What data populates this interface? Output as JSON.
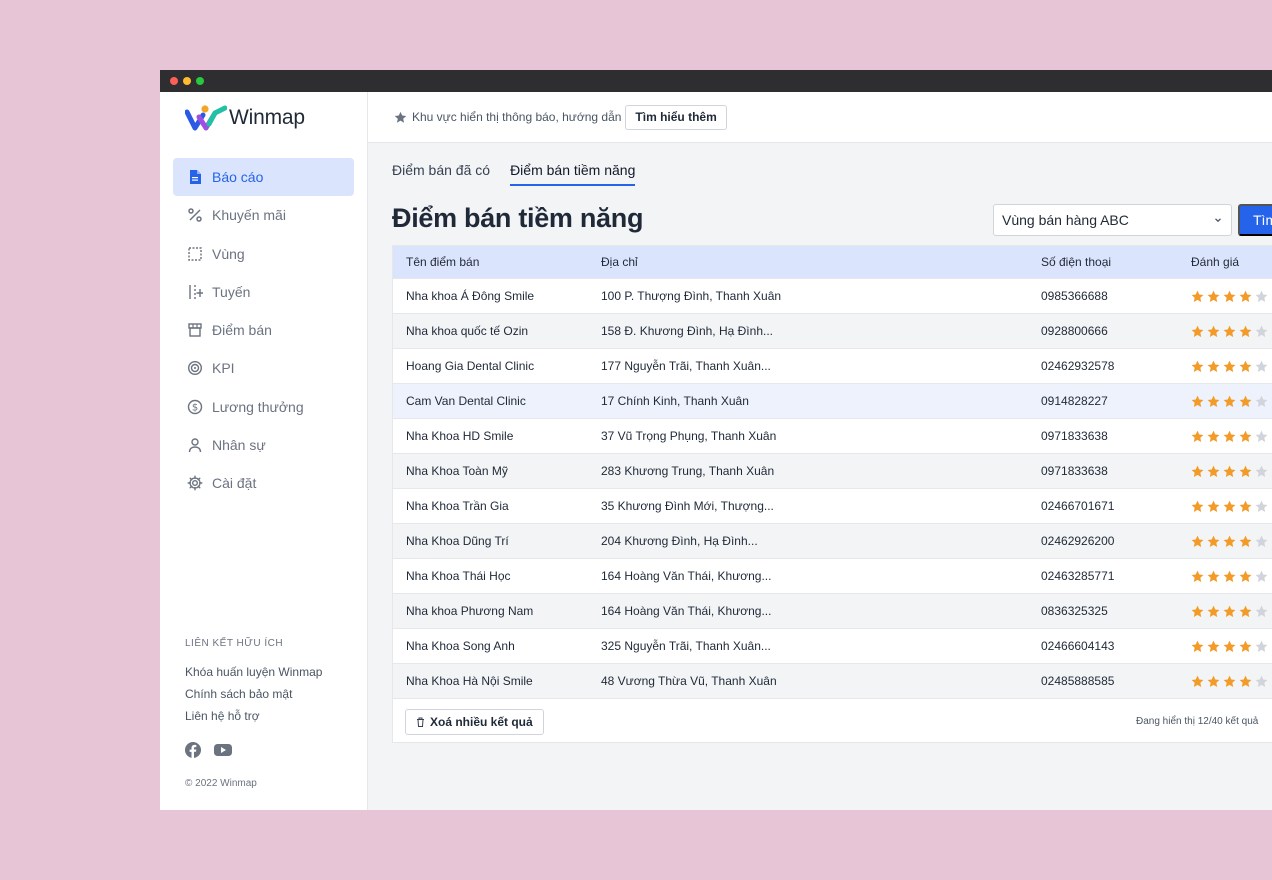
{
  "brand": {
    "name": "Winmap"
  },
  "colors": {
    "accent": "#2563eb",
    "active_bg": "#dbe4fd",
    "star": "#f29b28",
    "background": "#e8c5d6"
  },
  "sidebar": {
    "items": [
      {
        "label": "Báo cáo",
        "icon": "document-icon",
        "active": true
      },
      {
        "label": "Khuyến mãi",
        "icon": "percent-icon",
        "active": false
      },
      {
        "label": "Vùng",
        "icon": "region-icon",
        "active": false
      },
      {
        "label": "Tuyến",
        "icon": "route-icon",
        "active": false
      },
      {
        "label": "Điểm bán",
        "icon": "store-icon",
        "active": false
      },
      {
        "label": "KPI",
        "icon": "target-icon",
        "active": false
      },
      {
        "label": "Lương thưởng",
        "icon": "dollar-icon",
        "active": false
      },
      {
        "label": "Nhân sự",
        "icon": "user-icon",
        "active": false
      },
      {
        "label": "Cài đặt",
        "icon": "gear-icon",
        "active": false
      }
    ],
    "links_title": "LIÊN KẾT HỮU ÍCH",
    "links": [
      "Khóa huấn luyện Winmap",
      "Chính sách bảo mật",
      "Liên hệ hỗ trợ"
    ],
    "socials": [
      "facebook-icon",
      "youtube-icon"
    ],
    "copyright": "© 2022 Winmap"
  },
  "topbar": {
    "notice": "Khu vực hiển thị thông báo, hướng dẫn",
    "learn_more": "Tìm hiểu thêm"
  },
  "tabs": [
    {
      "label": "Điểm bán đã có",
      "active": false
    },
    {
      "label": "Điểm bán tiềm năng",
      "active": true
    }
  ],
  "page_title": "Điểm bán tiềm năng",
  "filter": {
    "region_value": "Vùng bán hàng ABC",
    "search_label": "Tìm"
  },
  "table": {
    "columns": [
      "Tên điểm bán",
      "Địa chỉ",
      "Số điện thoại",
      "Đánh giá"
    ],
    "rows": [
      {
        "name": "Nha khoa Á Đông Smile",
        "address": "100 P. Thượng Đình, Thanh Xuân",
        "phone": "0985366688",
        "rating": 4
      },
      {
        "name": "Nha khoa quốc tế Ozin",
        "address": "158 Đ. Khương Đình, Hạ Đình...",
        "phone": "0928800666",
        "rating": 4
      },
      {
        "name": "Hoang Gia Dental Clinic",
        "address": "177 Nguyễn Trãi, Thanh Xuân...",
        "phone": "02462932578",
        "rating": 4
      },
      {
        "name": "Cam Van Dental Clinic",
        "address": "17 Chính Kinh, Thanh Xuân",
        "phone": "0914828227",
        "rating": 4
      },
      {
        "name": "Nha Khoa HD Smile",
        "address": "37 Vũ Trọng Phụng, Thanh Xuân",
        "phone": "0971833638",
        "rating": 4
      },
      {
        "name": "Nha Khoa Toàn Mỹ",
        "address": "283 Khương Trung, Thanh Xuân",
        "phone": "0971833638",
        "rating": 4
      },
      {
        "name": "Nha Khoa Trần Gia",
        "address": "35 Khương Đình Mới, Thượng...",
        "phone": "02466701671",
        "rating": 4
      },
      {
        "name": "Nha Khoa Dũng Trí",
        "address": "204 Khương Đình, Hạ Đình...",
        "phone": "02462926200",
        "rating": 4
      },
      {
        "name": "Nha Khoa Thái Học",
        "address": "164 Hoàng Văn Thái, Khương...",
        "phone": "02463285771",
        "rating": 4
      },
      {
        "name": "Nha khoa Phương Nam",
        "address": "164 Hoàng Văn Thái, Khương...",
        "phone": "0836325325",
        "rating": 4
      },
      {
        "name": "Nha Khoa Song Anh",
        "address": "325 Nguyễn Trãi, Thanh Xuân...",
        "phone": "02466604143",
        "rating": 4
      },
      {
        "name": "Nha Khoa Hà Nội Smile",
        "address": "48 Vương Thừa Vũ, Thanh Xuân",
        "phone": "02485888585",
        "rating": 4
      }
    ],
    "delete_label": "Xoá nhiều kết quả",
    "count_text": "Đang hiển thị 12/40 kết quả"
  }
}
